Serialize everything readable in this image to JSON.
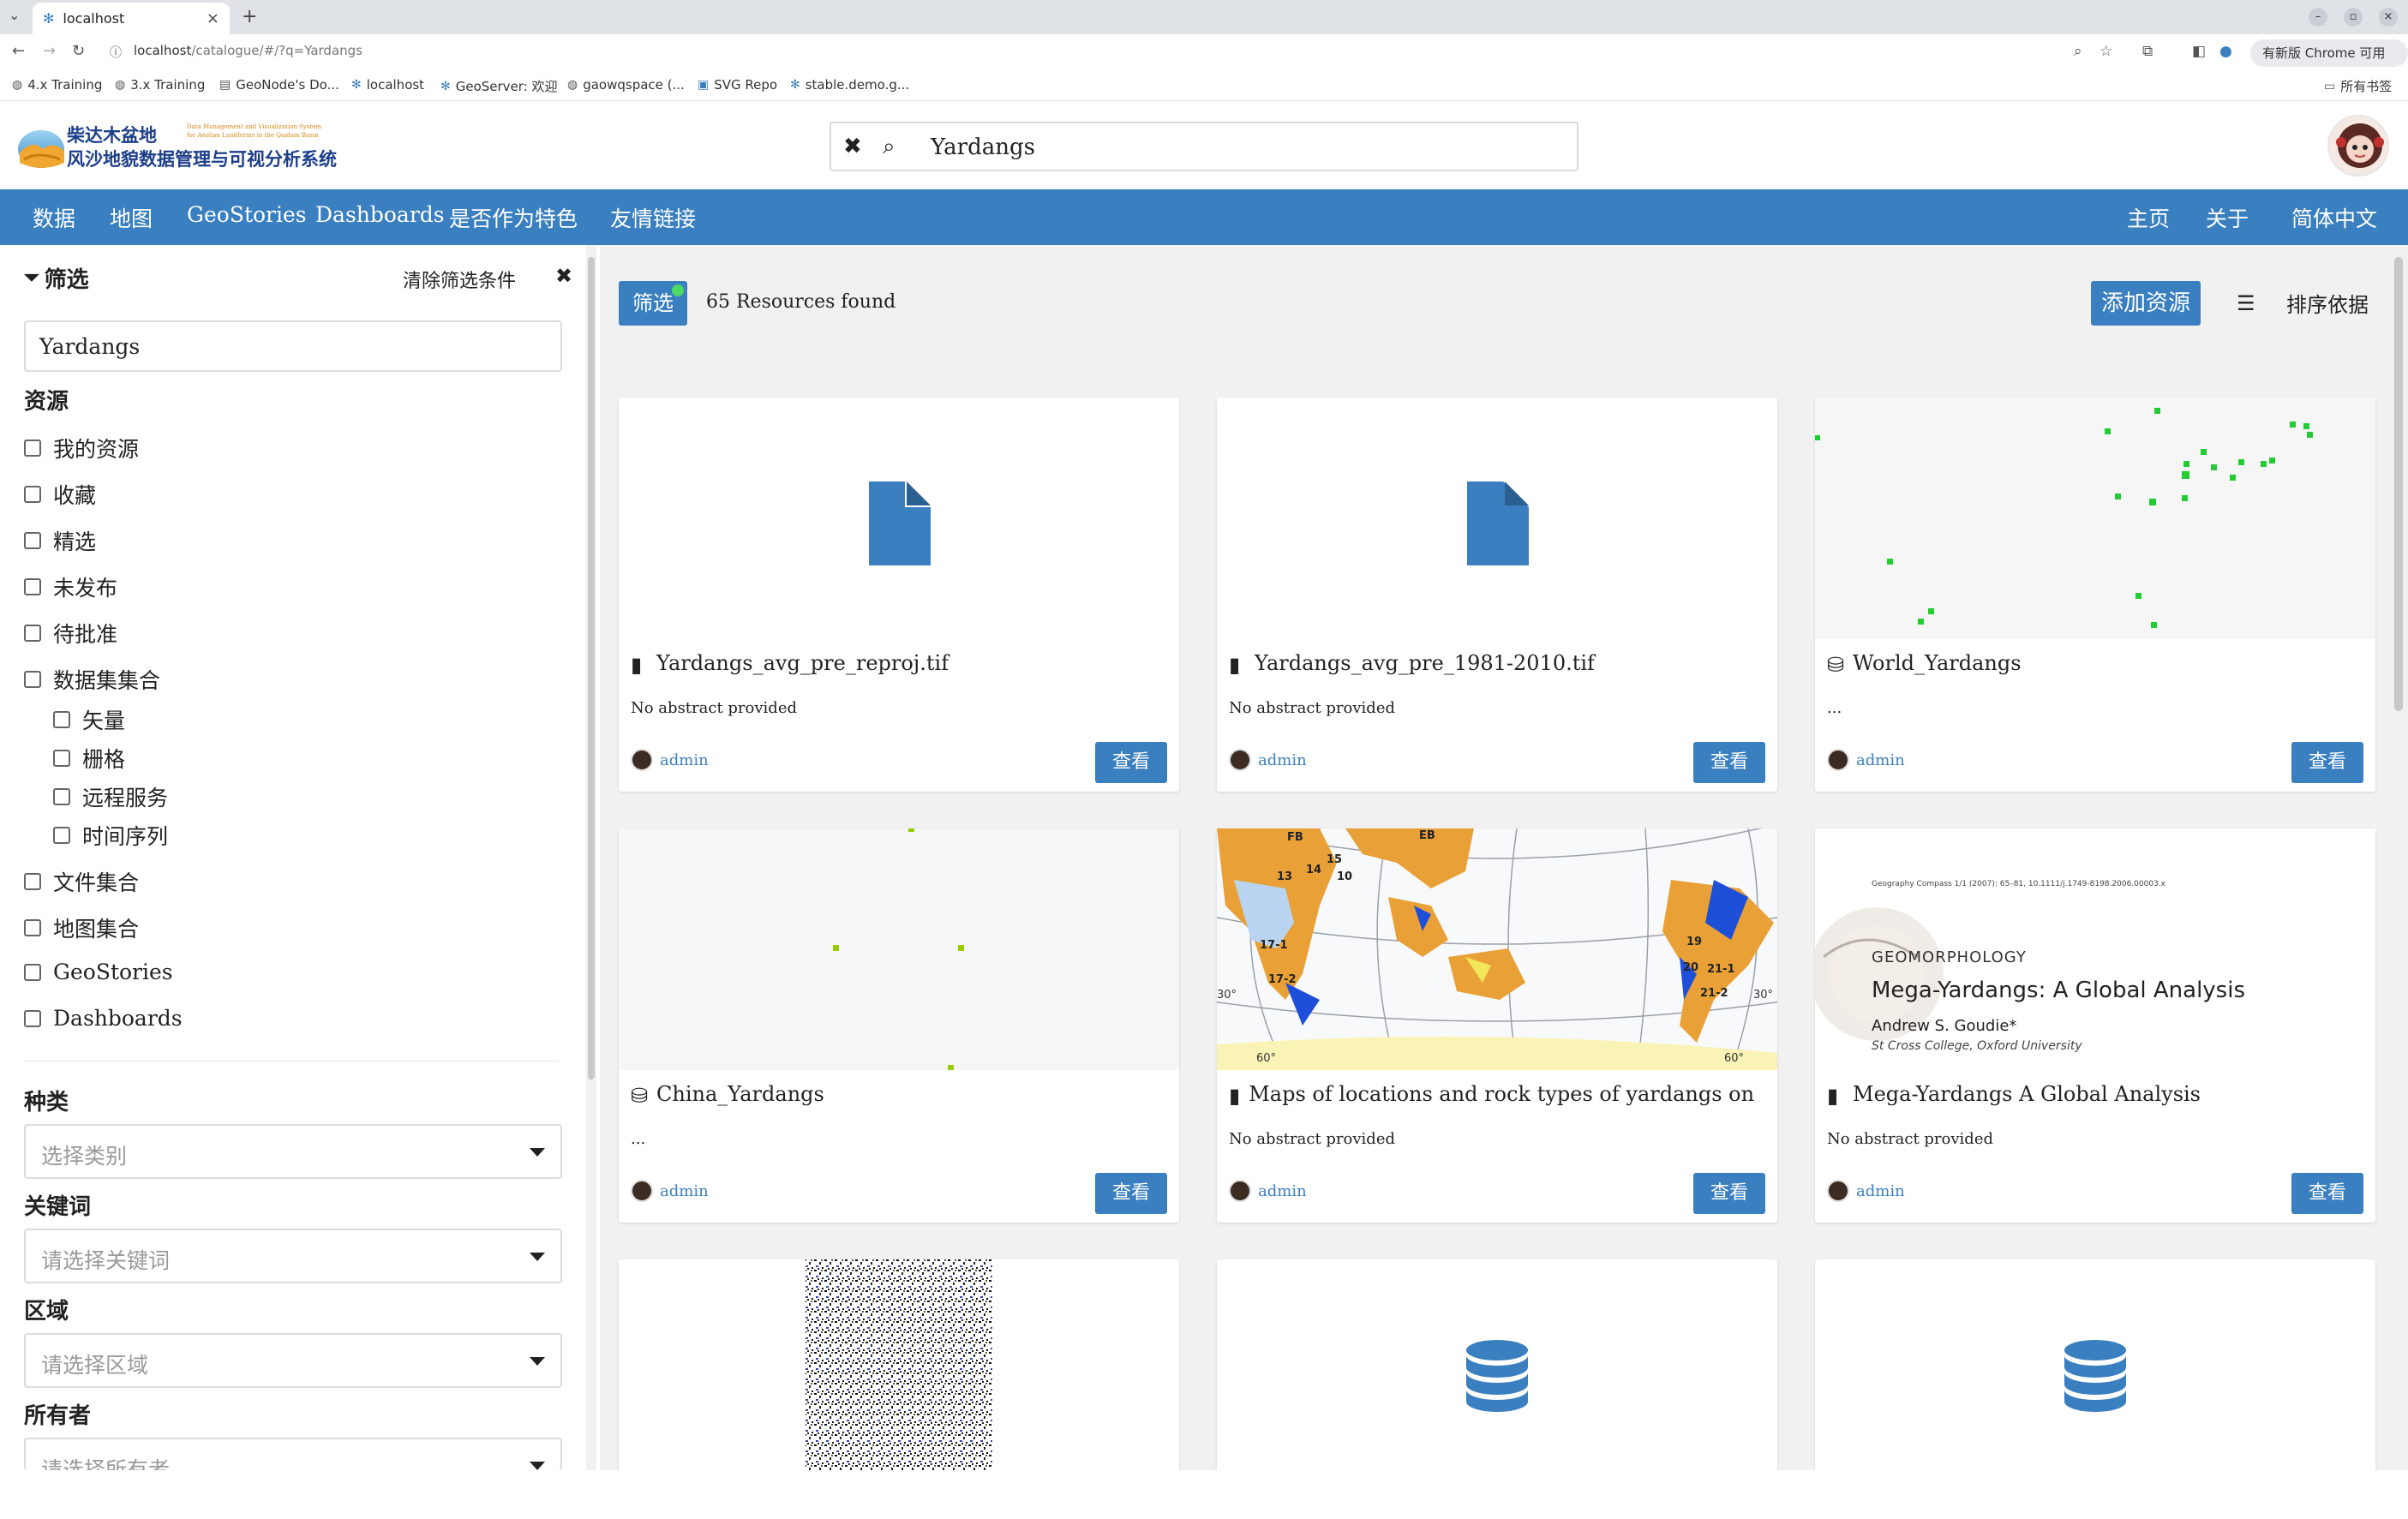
{
  "browser": {
    "tab_title": "localhost",
    "url_host": "localhost",
    "url_path": "/catalogue/#/?q=Yardangs",
    "update_label": "有新版 Chrome 可用",
    "bookmarks": [
      "4.x Training",
      "3.x Training",
      "GeoNode's Do...",
      "localhost",
      "GeoServer: 欢迎",
      "gaowqspace (...",
      "SVG Repo",
      "stable.demo.g..."
    ],
    "all_bookmarks": "所有书签"
  },
  "header": {
    "logo_title_line1": "柴达木盆地",
    "logo_title_line2": "风沙地貌数据管理与可视分析系统",
    "logo_en_line1": "Data Management and Visualization System",
    "logo_en_line2": "for Aeolian Landforms in the Qaidam Basin",
    "search_value": "Yardangs"
  },
  "nav": {
    "left": [
      "数据",
      "地图",
      "GeoStories",
      "Dashboards",
      "是否作为特色",
      "友情链接"
    ],
    "right": [
      "主页",
      "关于",
      "简体中文"
    ]
  },
  "sidebar": {
    "title": "筛选",
    "clear_label": "清除筛选条件",
    "search_value": "Yardangs",
    "resources_title": "资源",
    "resource_options": [
      "我的资源",
      "收藏",
      "精选",
      "未发布",
      "待批准",
      "数据集集合"
    ],
    "dataset_sub": [
      "矢量",
      "栅格",
      "远程服务",
      "时间序列"
    ],
    "more_options": [
      "文件集合",
      "地图集合",
      "GeoStories",
      "Dashboards"
    ],
    "category_title": "种类",
    "category_placeholder": "选择类别",
    "keyword_title": "关键词",
    "keyword_placeholder": "请选择关键词",
    "region_title": "区域",
    "region_placeholder": "请选择区域",
    "owner_title": "所有者",
    "owner_placeholder": "请选择所有者"
  },
  "toolbar": {
    "filter_label": "筛选",
    "found_text": "65 Resources found",
    "add_label": "添加资源",
    "sort_label": "排序依据"
  },
  "cards": [
    {
      "title": "Yardangs_avg_pre_reproj.tif",
      "abstract": "No abstract provided",
      "owner": "admin",
      "view": "查看",
      "type": "document"
    },
    {
      "title": "Yardangs_avg_pre_1981-2010.tif",
      "abstract": "No abstract provided",
      "owner": "admin",
      "view": "查看",
      "type": "document"
    },
    {
      "title": "World_Yardangs",
      "abstract": "...",
      "owner": "admin",
      "view": "查看",
      "type": "dataset"
    },
    {
      "title": "China_Yardangs",
      "abstract": "...",
      "owner": "admin",
      "view": "查看",
      "type": "dataset"
    },
    {
      "title": "Maps of locations and rock types of yardangs on Earth (d...",
      "abstract": "No abstract provided",
      "owner": "admin",
      "view": "查看",
      "type": "document"
    },
    {
      "title": "Mega-Yardangs A Global Analysis",
      "abstract": "No abstract provided",
      "owner": "admin",
      "view": "查看",
      "type": "document"
    }
  ],
  "paper_thumb": {
    "citation": "Geography Compass 1/1 (2007): 65–81, 10.1111/j.1749-8198.2006.00003.x",
    "category": "GEOMORPHOLOGY",
    "title": "Mega-Yardangs: A Global Analysis",
    "author": "Andrew S. Goudie*",
    "affiliation": "St Cross College, Oxford University"
  },
  "map_thumb_labels": [
    "FB",
    "EB",
    "13",
    "15",
    "14",
    "10",
    "17-1",
    "17-2",
    "19",
    "20",
    "21-1",
    "21-2",
    "60°",
    "30°"
  ],
  "colors": {
    "primary": "#3a7fbf",
    "badge": "#4cd964",
    "point_green": "#22cc33",
    "point_olive": "#99cc00"
  }
}
